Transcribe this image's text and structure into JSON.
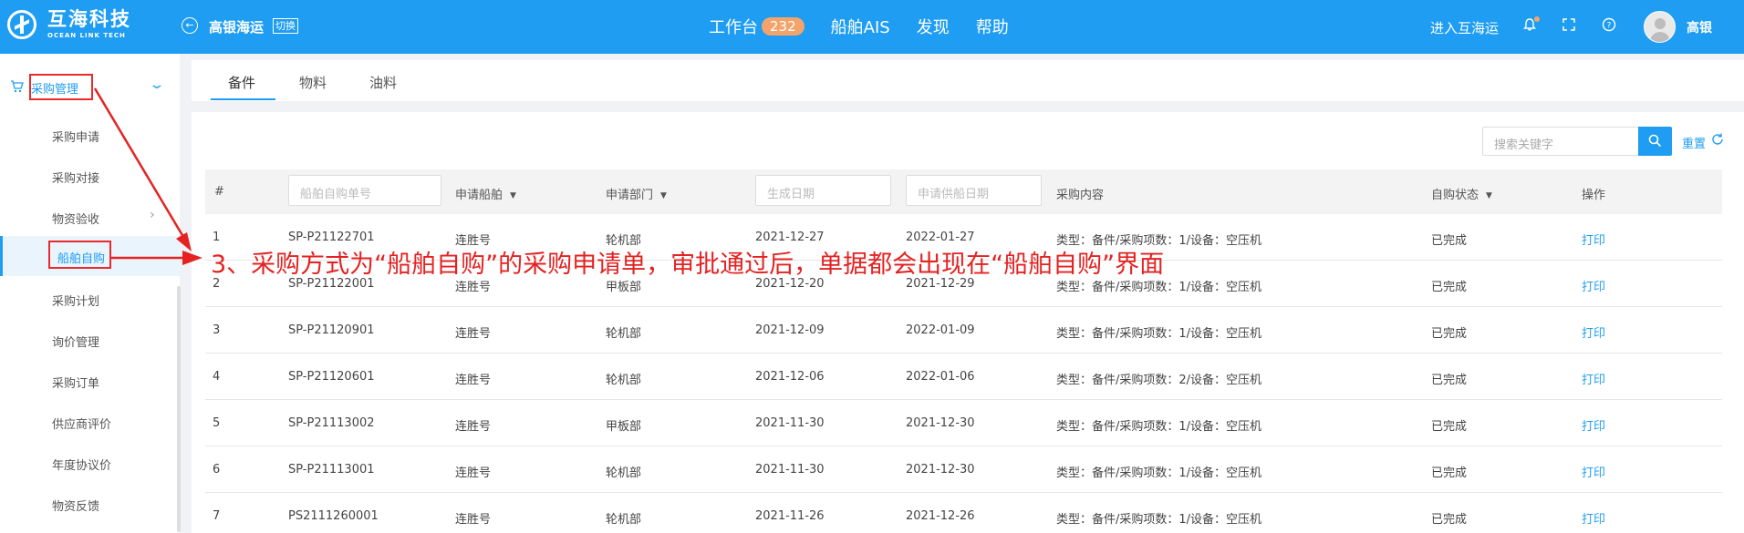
{
  "header": {
    "logo_cn": "互海科技",
    "logo_en": "OCEAN LINK TECH",
    "company": "高银海运",
    "switch_label": "切换",
    "nav": [
      {
        "label": "工作台",
        "badge": "232"
      },
      {
        "label": "船舶AIS"
      },
      {
        "label": "发现"
      },
      {
        "label": "帮助"
      }
    ],
    "enter_label": "进入互海运",
    "username": "高银"
  },
  "sidebar": {
    "section_label": "采购管理",
    "items": [
      {
        "label": "采购申请"
      },
      {
        "label": "采购对接"
      },
      {
        "label": "物资验收"
      },
      {
        "label": "船舶自购"
      },
      {
        "label": "采购计划"
      },
      {
        "label": "询价管理"
      },
      {
        "label": "采购订单"
      },
      {
        "label": "供应商评价"
      },
      {
        "label": "年度协议价"
      },
      {
        "label": "物资反馈"
      }
    ]
  },
  "tabs": [
    {
      "label": "备件"
    },
    {
      "label": "物料"
    },
    {
      "label": "油料"
    }
  ],
  "toolbar": {
    "search_placeholder": "搜索关键字",
    "reset_label": "重置"
  },
  "table": {
    "headers": {
      "index": "#",
      "order_no_placeholder": "船舶自购单号",
      "ship": "申请船舶",
      "dept": "申请部门",
      "gen_date_placeholder": "生成日期",
      "supply_date_placeholder": "申请供船日期",
      "content": "采购内容",
      "status": "自购状态",
      "action": "操作"
    },
    "rows": [
      {
        "idx": "1",
        "no": "SP-P21122701",
        "ship": "连胜号",
        "dept": "轮机部",
        "gen": "2021-12-27",
        "supply": "2022-01-27",
        "content": "类型：备件/采购项数：1/设备：空压机",
        "status": "已完成",
        "action": "打印"
      },
      {
        "idx": "2",
        "no": "SP-P21122001",
        "ship": "连胜号",
        "dept": "甲板部",
        "gen": "2021-12-20",
        "supply": "2021-12-29",
        "content": "类型：备件/采购项数：1/设备：空压机",
        "status": "已完成",
        "action": "打印"
      },
      {
        "idx": "3",
        "no": "SP-P21120901",
        "ship": "连胜号",
        "dept": "轮机部",
        "gen": "2021-12-09",
        "supply": "2022-01-09",
        "content": "类型：备件/采购项数：1/设备：空压机",
        "status": "已完成",
        "action": "打印"
      },
      {
        "idx": "4",
        "no": "SP-P21120601",
        "ship": "连胜号",
        "dept": "轮机部",
        "gen": "2021-12-06",
        "supply": "2022-01-06",
        "content": "类型：备件/采购项数：2/设备：空压机",
        "status": "已完成",
        "action": "打印"
      },
      {
        "idx": "5",
        "no": "SP-P21113002",
        "ship": "连胜号",
        "dept": "甲板部",
        "gen": "2021-11-30",
        "supply": "2021-12-30",
        "content": "类型：备件/采购项数：1/设备：空压机",
        "status": "已完成",
        "action": "打印"
      },
      {
        "idx": "6",
        "no": "SP-P21113001",
        "ship": "连胜号",
        "dept": "轮机部",
        "gen": "2021-11-30",
        "supply": "2021-12-30",
        "content": "类型：备件/采购项数：1/设备：空压机",
        "status": "已完成",
        "action": "打印"
      },
      {
        "idx": "7",
        "no": "PS2111260001",
        "ship": "连胜号",
        "dept": "轮机部",
        "gen": "2021-11-26",
        "supply": "2021-12-26",
        "content": "类型：备件/采购项数：1/设备：空压机",
        "status": "已完成",
        "action": "打印"
      }
    ]
  },
  "annotation": {
    "text": "3、采购方式为“船舶自购”的采购申请单，审批通过后，单据都会出现在“船舶自购”界面"
  },
  "colors": {
    "primary": "#1e9df2",
    "badge": "#f4a46b",
    "annotation": "#e42222"
  }
}
